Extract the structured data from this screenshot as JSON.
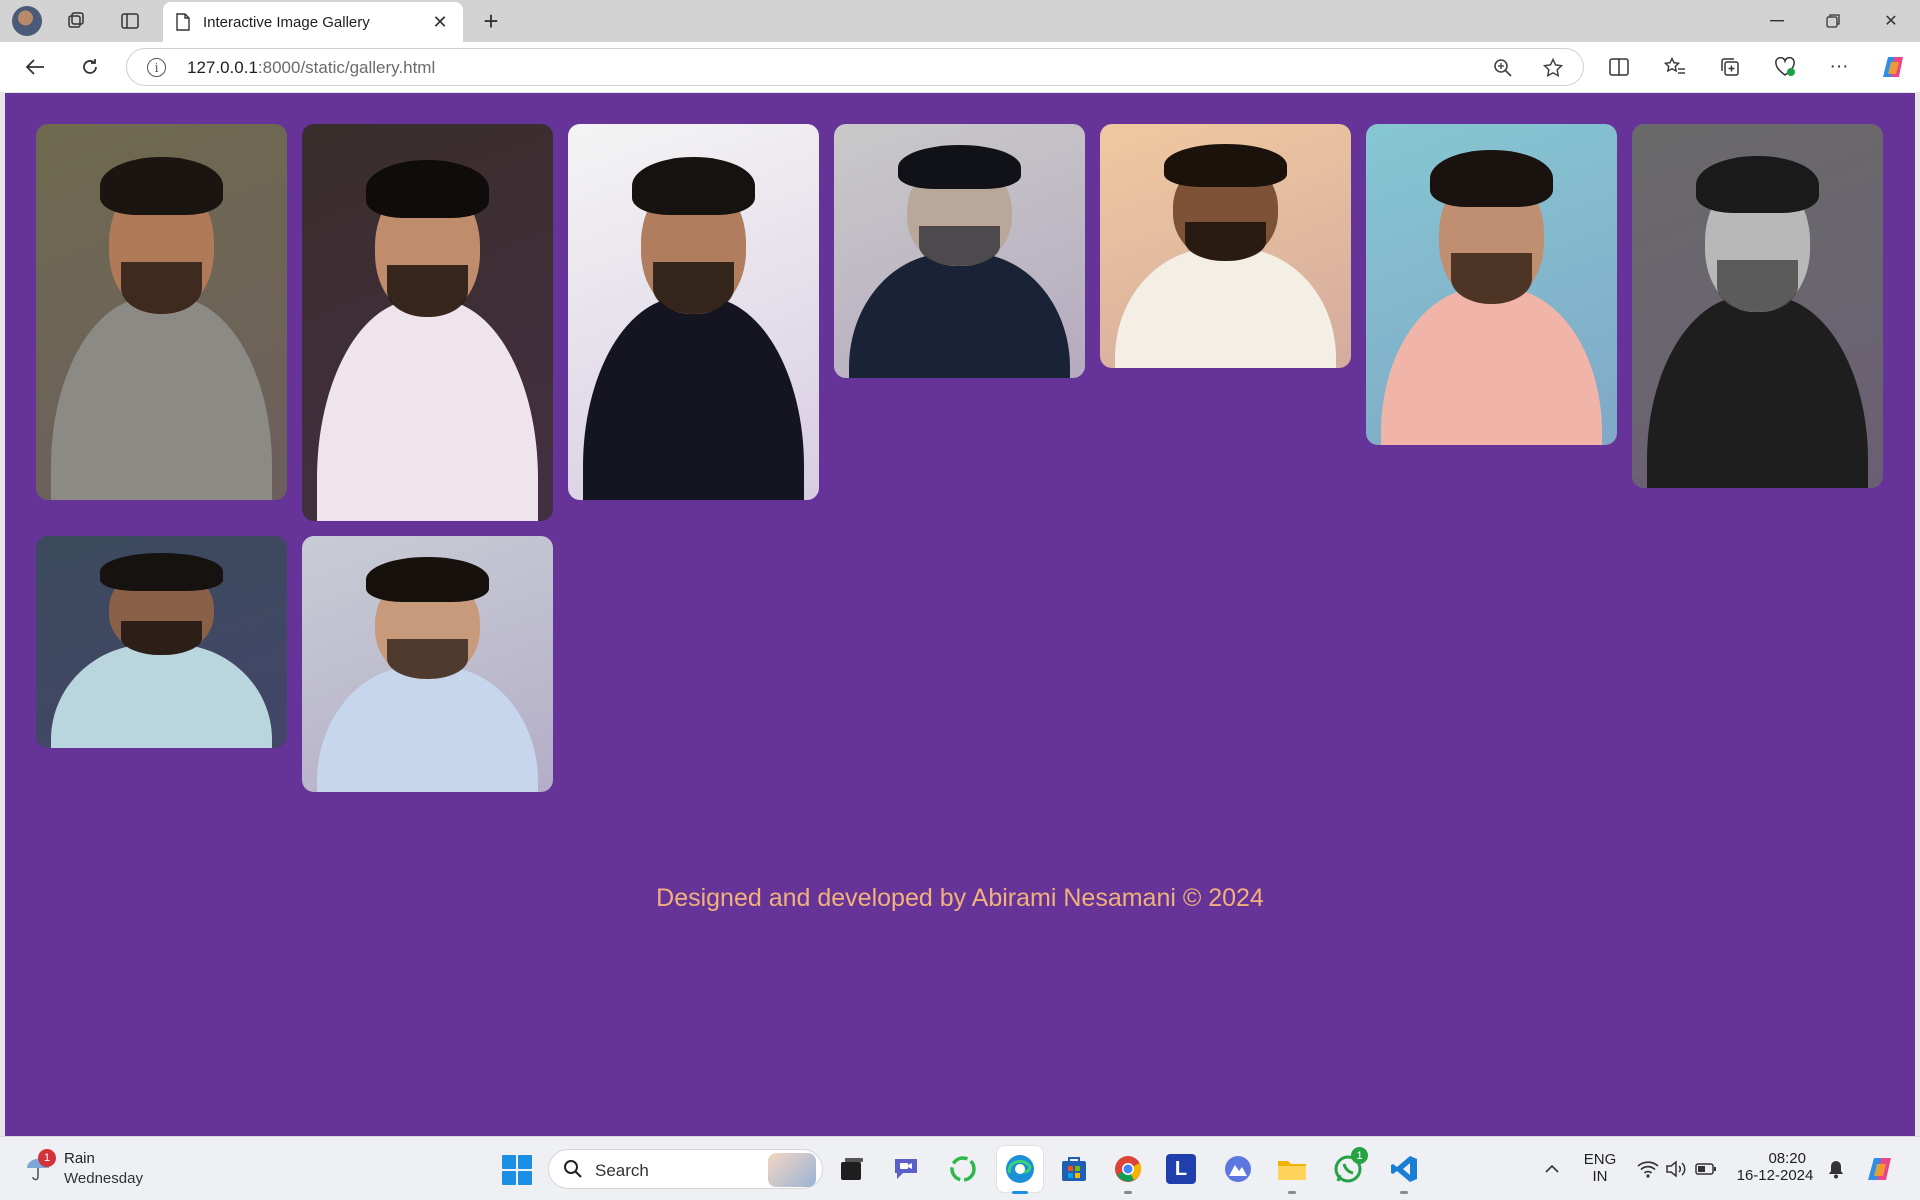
{
  "browser": {
    "tab_title": "Interactive Image Gallery",
    "url_host": "127.0.0.1",
    "url_rest": ":8000/static/gallery.html"
  },
  "gallery": {
    "photos": [
      {
        "label": "photo-1",
        "bg": "#6e6a4f",
        "skin": "#b07a58",
        "hair": "#1b1512",
        "beard": "#2a1c14",
        "shirt": "#8c8a84"
      },
      {
        "label": "photo-2",
        "bg": "#3a2e2c",
        "skin": "#c08d6c",
        "hair": "#0f0c0b",
        "beard": "#1f1410",
        "shirt": "#efe4ec"
      },
      {
        "label": "photo-3",
        "bg": "#f4f4f4",
        "skin": "#b07d5f",
        "hair": "#161210",
        "beard": "#1e1612",
        "shirt": "#151522"
      },
      {
        "label": "photo-4",
        "bg": "#c9c9c9",
        "skin": "#b9a89a",
        "hair": "#101218",
        "beard": "#3a3a40",
        "shirt": "#1a2238"
      },
      {
        "label": "photo-5",
        "bg": "#f0c9a0",
        "skin": "#7e5236",
        "hair": "#1b120c",
        "beard": "#1b120c",
        "shirt": "#f4efe4"
      },
      {
        "label": "photo-6",
        "bg": "#86c6d2",
        "skin": "#c08e70",
        "hair": "#1a120e",
        "beard": "#3a2418",
        "shirt": "#f0b4a8"
      },
      {
        "label": "photo-7",
        "bg": "#6a6a6a",
        "skin": "#b8b8b8",
        "hair": "#1a1a1a",
        "beard": "#4a4a4a",
        "shirt": "#1e1e1e"
      },
      {
        "label": "photo-8",
        "bg": "#3b4a5c",
        "skin": "#8a6048",
        "hair": "#161210",
        "beard": "#1a1410",
        "shirt": "#b9d6df"
      },
      {
        "label": "photo-9",
        "bg": "#c8ccd4",
        "skin": "#c89a7c",
        "hair": "#17110e",
        "beard": "#3a2a20",
        "shirt": "#c7d6ec"
      }
    ],
    "footer_text": "Designed and developed by Abirami Nesamani © 2024"
  },
  "taskbar": {
    "weather_title": "Rain",
    "weather_day": "Wednesday",
    "weather_badge": "1",
    "search_label": "Search",
    "whatsapp_badge": "1",
    "lang_top": "ENG",
    "lang_bottom": "IN",
    "time": "08:20",
    "date": "16-12-2024"
  },
  "colors": {
    "page_bg": "#663399",
    "footer_text": "#f0b27a",
    "accent_blue": "#1a8fe3"
  }
}
